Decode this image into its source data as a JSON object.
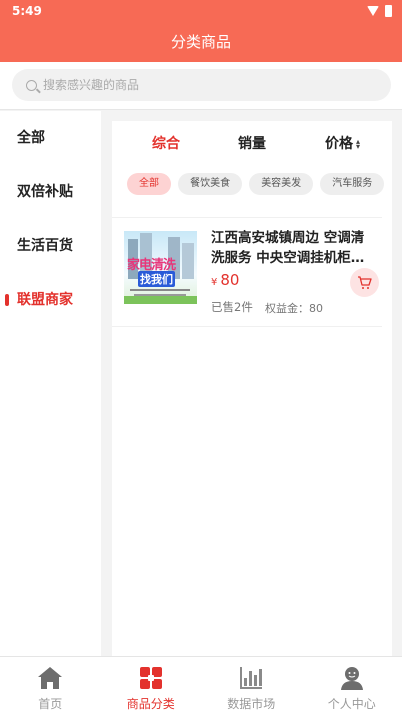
{
  "status_bar": {
    "time": "5:49"
  },
  "header": {
    "title": "分类商品"
  },
  "search": {
    "placeholder": "搜索感兴趣的商品"
  },
  "sidebar": {
    "items": [
      {
        "label": "全部",
        "active": false
      },
      {
        "label": "双倍补贴",
        "active": false
      },
      {
        "label": "生活百货",
        "active": false
      },
      {
        "label": "联盟商家",
        "active": true
      }
    ]
  },
  "sort": {
    "comprehensive": "综合",
    "sales": "销量",
    "price": "价格",
    "active": "comprehensive"
  },
  "chips": [
    {
      "label": "全部",
      "active": true
    },
    {
      "label": "餐饮美食",
      "active": false
    },
    {
      "label": "美容美发",
      "active": false
    },
    {
      "label": "汽车服务",
      "active": false
    }
  ],
  "product": {
    "title": "江西高安城镇周边 空调清洗服务 中央空调挂机柜…",
    "currency": "¥",
    "price": "80",
    "sold": "已售2件",
    "bonus": "权益金：80",
    "image_text": {
      "line1_a": "家电",
      "line1_b": "清洗",
      "line2": "找我们"
    }
  },
  "tabbar": {
    "items": [
      {
        "label": "首页",
        "icon": "home-icon",
        "active": false
      },
      {
        "label": "商品分类",
        "icon": "category-icon",
        "active": true
      },
      {
        "label": "数据市场",
        "icon": "bar-chart-icon",
        "active": false
      },
      {
        "label": "个人中心",
        "icon": "user-icon",
        "active": false
      }
    ]
  },
  "colors": {
    "primary": "#f76a55",
    "accent": "#e3322d",
    "inactive": "#999999"
  }
}
